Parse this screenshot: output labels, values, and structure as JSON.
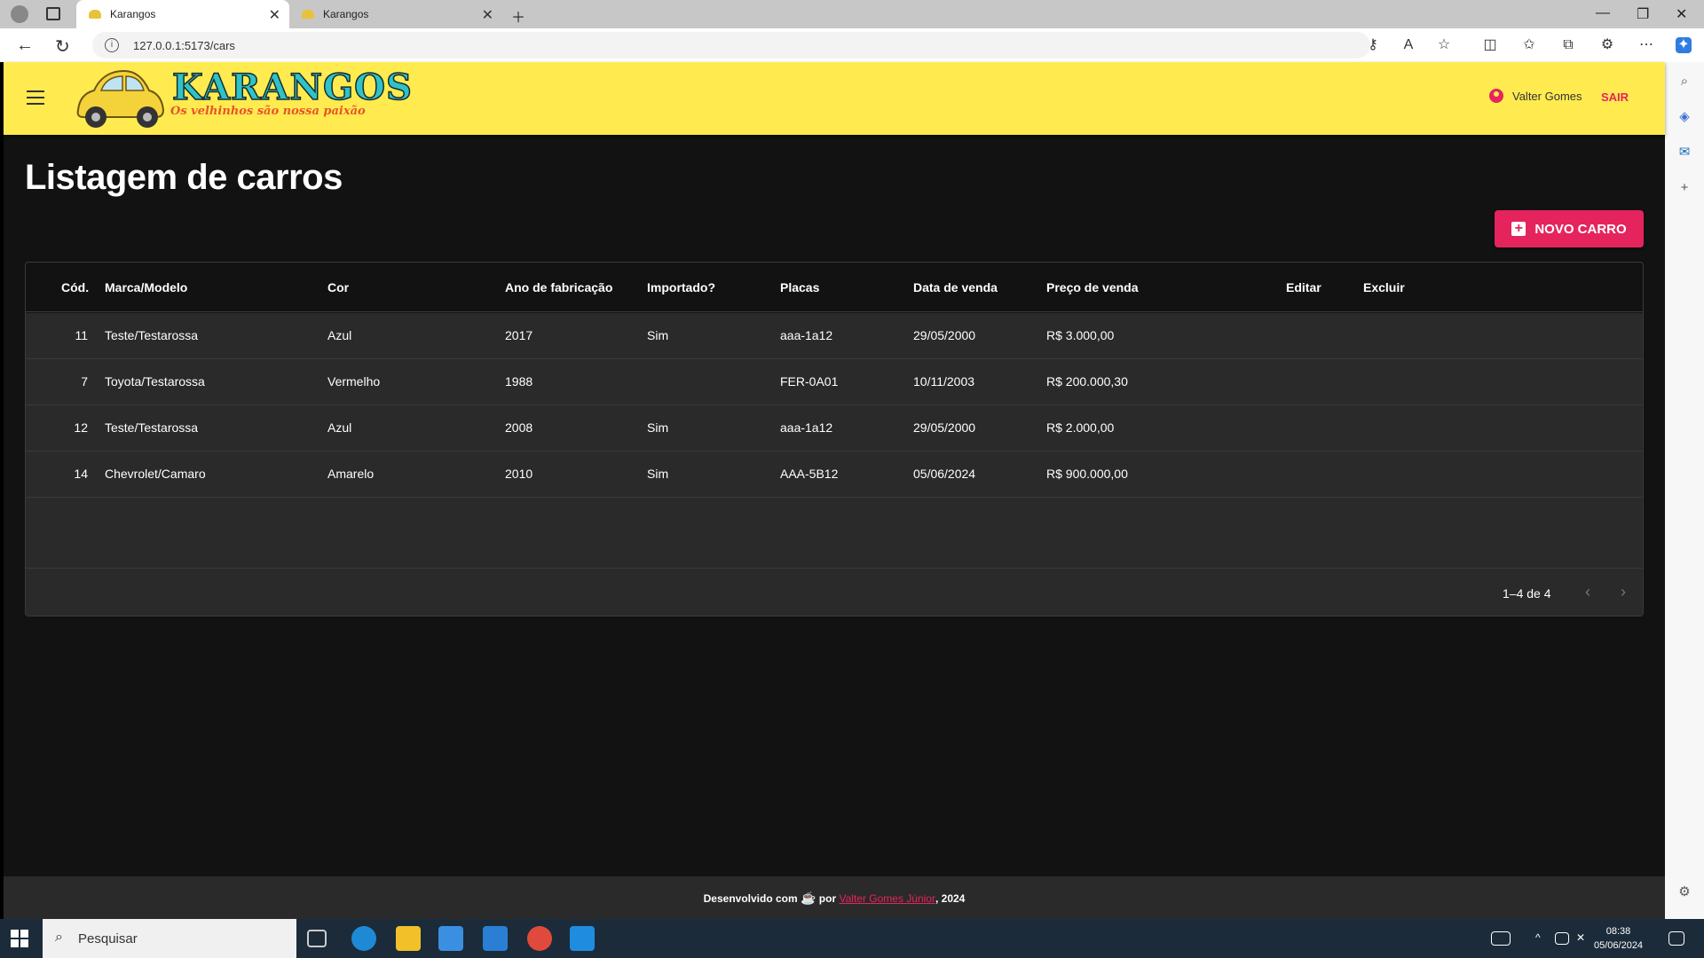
{
  "browser": {
    "tabs": [
      {
        "title": "Karangos",
        "active": true
      },
      {
        "title": "Karangos",
        "active": false
      }
    ],
    "url": "127.0.0.1:5173/cars"
  },
  "appbar": {
    "logo_title": "KARANGOS",
    "logo_slogan": "Os velhinhos são nossa paixão",
    "user_name": "Valter Gomes",
    "logout_label": "SAIR"
  },
  "page": {
    "title": "Listagem de carros",
    "new_button_label": "NOVO CARRO"
  },
  "table": {
    "columns": [
      "Cód.",
      "Marca/Modelo",
      "Cor",
      "Ano de fabricação",
      "Importado?",
      "Placas",
      "Data de venda",
      "Preço de venda",
      "Editar",
      "Excluir"
    ],
    "rows": [
      {
        "id": "11",
        "brand_model": "Teste/Testarossa",
        "color": "Azul",
        "year": "2017",
        "imported": "Sim",
        "plates": "aaa-1a12",
        "selling_date": "29/05/2000",
        "price": "R$ 3.000,00"
      },
      {
        "id": "7",
        "brand_model": "Toyota/Testarossa",
        "color": "Vermelho",
        "year": "1988",
        "imported": "",
        "plates": "FER-0A01",
        "selling_date": "10/11/2003",
        "price": "R$ 200.000,30"
      },
      {
        "id": "12",
        "brand_model": "Teste/Testarossa",
        "color": "Azul",
        "year": "2008",
        "imported": "Sim",
        "plates": "aaa-1a12",
        "selling_date": "29/05/2000",
        "price": "R$ 2.000,00"
      },
      {
        "id": "14",
        "brand_model": "Chevrolet/Camaro",
        "color": "Amarelo",
        "year": "2010",
        "imported": "Sim",
        "plates": "AAA-5B12",
        "selling_date": "05/06/2024",
        "price": "R$ 900.000,00"
      }
    ],
    "pagination": "1–4 de 4"
  },
  "footer": {
    "prefix": "Desenvolvido com",
    "by": "por",
    "author": "Valter Gomes Júnior",
    "suffix": ", 2024"
  },
  "taskbar": {
    "search_placeholder": "Pesquisar",
    "time": "08:38",
    "date": "05/06/2024"
  },
  "colors": {
    "appbar": "#ffeb50",
    "accent": "#e5245e",
    "background": "#121212",
    "row": "#2a2a2a"
  }
}
